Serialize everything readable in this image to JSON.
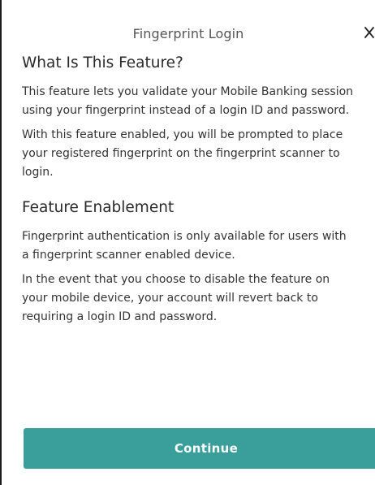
{
  "modal": {
    "title": "Fingerprint Login"
  },
  "sections": [
    {
      "title": "What Is This Feature?",
      "paragraphs": [
        "This feature lets you validate your Mobile Banking session using your fingerprint instead of a login ID and password.",
        "With this feature enabled, you will be prompted to place your registered fingerprint on the fingerprint scanner to login."
      ]
    },
    {
      "title": "Feature Enablement",
      "paragraphs": [
        "Fingerprint authentication is only available for users with a fingerprint scanner enabled device.",
        "In the event that you choose to disable the feature on your mobile device, your account will revert back to requiring a login ID and password."
      ]
    }
  ],
  "actions": {
    "continue_label": "Continue"
  },
  "icons": {
    "close": "close-icon"
  },
  "colors": {
    "primary_button": "#3a9e9a",
    "button_text": "#ffffff",
    "title_text": "#555555",
    "body_text": "#333333"
  }
}
